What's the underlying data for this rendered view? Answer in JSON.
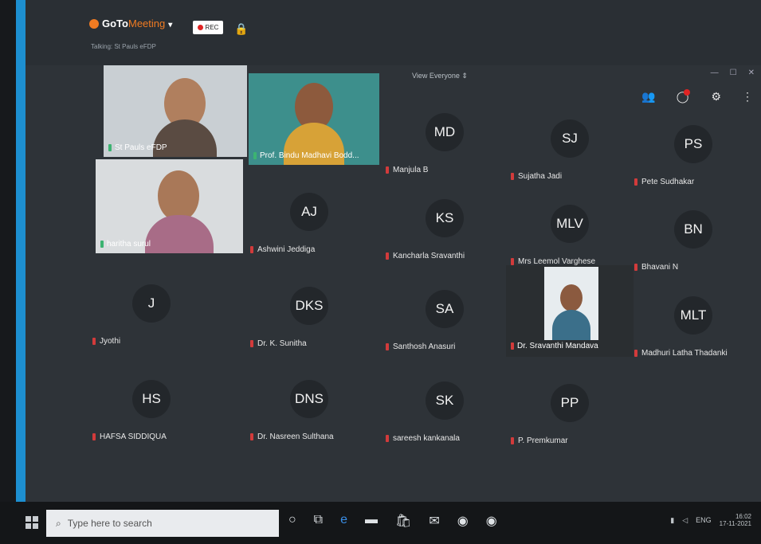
{
  "app": {
    "brand_primary": "GoTo",
    "brand_secondary": "Meeting",
    "rec_label": "REC",
    "talking": "Talking: St Pauls eFDP",
    "view_label": "View Everyone",
    "accent_color": "#1d8fd0",
    "brand_color": "#f07b22"
  },
  "videos": [
    {
      "name": "St Pauls eFDP"
    },
    {
      "name": "Prof. Bindu Madhavi Bodd..."
    },
    {
      "name": "haritha surul"
    }
  ],
  "tiles": [
    {
      "initials": "MD",
      "name": "Manjula B"
    },
    {
      "initials": "SJ",
      "name": "Sujatha Jadi"
    },
    {
      "initials": "PS",
      "name": "Pete Sudhakar"
    },
    {
      "initials": "AJ",
      "name": "Ashwini Jeddiga"
    },
    {
      "initials": "KS",
      "name": "Kancharla Sravanthi"
    },
    {
      "initials": "MLV",
      "name": "Mrs Leemol Varghese"
    },
    {
      "initials": "BN",
      "name": "Bhavani N"
    },
    {
      "initials": "J",
      "name": "Jyothi"
    },
    {
      "initials": "DKS",
      "name": "Dr. K. Sunitha"
    },
    {
      "initials": "SA",
      "name": "Santhosh Anasuri"
    },
    {
      "initials": "",
      "name": "Dr. Sravanthi Mandava"
    },
    {
      "initials": "MLT",
      "name": "Madhuri Latha Thadanki"
    },
    {
      "initials": "HS",
      "name": "HAFSA SIDDIQUA"
    },
    {
      "initials": "DNS",
      "name": "Dr. Nasreen Sulthana"
    },
    {
      "initials": "SK",
      "name": "sareesh kankanala"
    },
    {
      "initials": "PP",
      "name": "P. Premkumar"
    }
  ],
  "taskbar": {
    "search_placeholder": "Type here to search",
    "tray_lang": "ENG",
    "time": "16:02",
    "date": "17-11-2021"
  }
}
